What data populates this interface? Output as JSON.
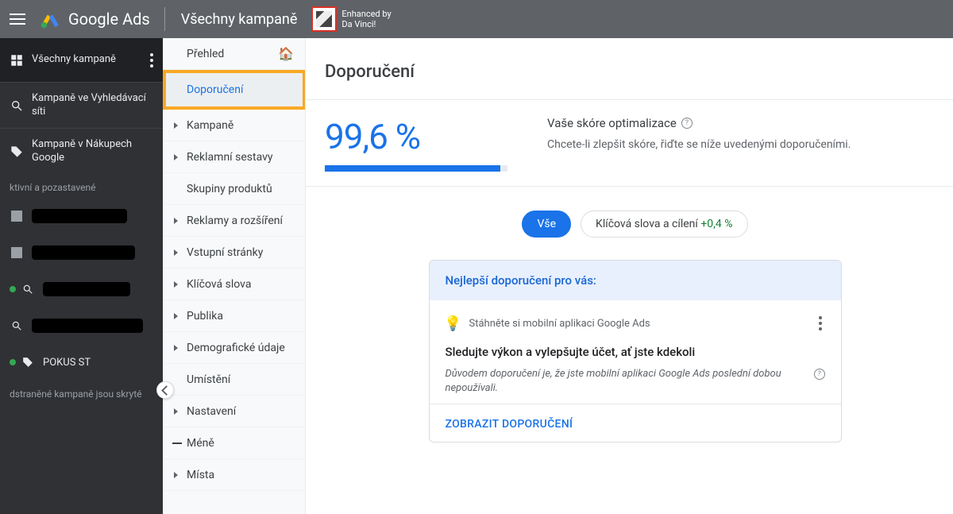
{
  "topbar": {
    "brand": "Google Ads",
    "title": "Všechny kampaně",
    "enhanced_line1": "Enhanced by",
    "enhanced_line2": "Da Vinci!"
  },
  "sidebar": {
    "all_campaigns": "Všechny kampaně",
    "search_campaigns": "Kampaně ve Vyhledávací síti",
    "shopping_campaigns": "Kampaně v Nákupech Google",
    "status_header": "ktivní a pozastavené",
    "item_pokus": "POKUS ST",
    "removed_note": "dstraněné kampaně jsou skryté"
  },
  "nav2": {
    "items": [
      "Přehled",
      "Doporučení",
      "Kampaně",
      "Reklamní sestavy",
      "Skupiny produktů",
      "Reklamy a rozšíření",
      "Vstupní stránky",
      "Klíčová slova",
      "Publika",
      "Demografické údaje",
      "Umístění",
      "Nastavení",
      "Méně",
      "Místa"
    ]
  },
  "main": {
    "title": "Doporučení",
    "score_value": "99,6 %",
    "score_heading": "Vaše skóre optimalizace",
    "score_sub": "Chcete-li zlepšit skóre, řiďte se níže uvedenými doporučeními.",
    "chip_all": "Vše",
    "chip_kw": "Klíčová slova a cílení ",
    "chip_kw_delta": "+0,4 %",
    "card": {
      "head": "Nejlepší doporučení pro vás:",
      "hint": "Stáhněte si mobilní aplikaci Google Ads",
      "title": "Sledujte výkon a vylepšujte účet, ať jste kdekoli",
      "desc": "Důvodem doporučení je, že jste mobilní aplikaci Google Ads poslední dobou nepoužívali.",
      "cta": "ZOBRAZIT DOPORUČENÍ"
    }
  }
}
